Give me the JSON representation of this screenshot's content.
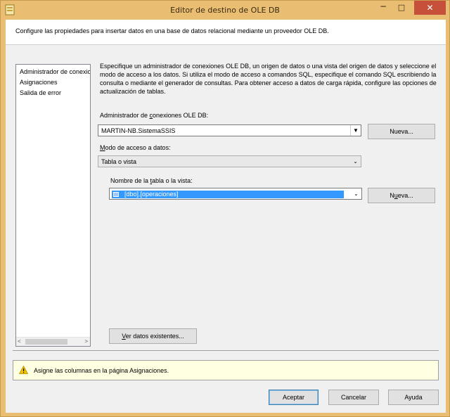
{
  "window": {
    "title": "Editor de destino de OLE DB",
    "minimize_glyph": "−",
    "maximize_glyph": "□",
    "close_glyph": "✕"
  },
  "header": {
    "text": "Configure las propiedades para insertar datos en una base de datos relacional mediante un proveedor OLE DB."
  },
  "sidebar": {
    "items": [
      {
        "label": "Administrador de conexiones",
        "selected": true
      },
      {
        "label": "Asignaciones"
      },
      {
        "label": "Salida de error"
      }
    ],
    "scroll_left": "<",
    "scroll_right": ">"
  },
  "main": {
    "description": "Especifique un administrador de conexiones OLE DB, un origen de datos o una vista del origen de datos y seleccione el modo de acceso a los datos. Si utiliza el modo de acceso a comandos SQL, especifique el comando SQL escribiendo la consulta o mediante el generador de consultas. Para obtener acceso a datos de carga rápida, configure las opciones de actualización de tablas.",
    "connection_label_pre": "Administrador de ",
    "connection_label_key": "c",
    "connection_label_post": "onexiones OLE DB:",
    "connection_value": "MARTIN-NB.SistemaSSIS",
    "connection_new_button": "Nueva...",
    "access_mode_label_key": "M",
    "access_mode_label_post": "odo de acceso a datos:",
    "access_mode_value": "Tabla o vista",
    "table_label_pre": "Nombre de la ",
    "table_label_key": "t",
    "table_label_post": "abla o la vista:",
    "table_value": "[dbo].[operaciones]",
    "table_new_button_pre": "N",
    "table_new_button_key": "u",
    "table_new_button_post": "eva...",
    "view_data_button_key": "V",
    "view_data_button_post": "er datos existentes...",
    "dropdown_glyph": "▼",
    "dropdown_glyph_small": "⌄"
  },
  "warning": {
    "text": "Asigne las columnas en la página Asignaciones.",
    "icon_color": "#f5c400"
  },
  "footer": {
    "ok": "Aceptar",
    "cancel": "Cancelar",
    "help": "Ayuda"
  }
}
